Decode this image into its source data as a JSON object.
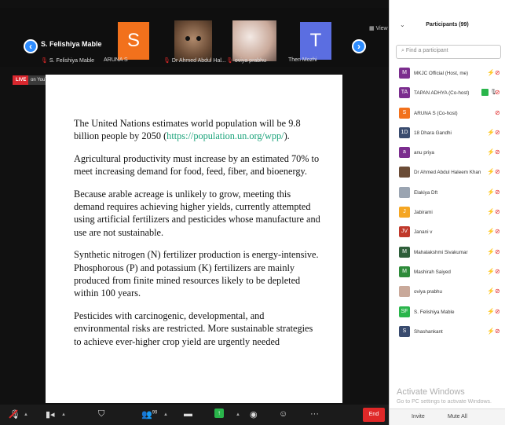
{
  "topstrip": {
    "active_speaker": "S. Felishiya Mable",
    "speaker_label": "S. Felishiya Mable",
    "tiles": [
      {
        "name": "ARUNA S",
        "avatar": "S"
      },
      {
        "name": "Dr Ahmed Abdul Hal..."
      },
      {
        "name": "oviya prabhu"
      },
      {
        "name": "Then Mozhi",
        "avatar": "T"
      }
    ],
    "view_label": "View"
  },
  "live": {
    "badge": "LIVE",
    "stream": "on YouTube ▾"
  },
  "slide": {
    "p1_text": "The United Nations estimates world population will be 9.8 billion people by 2050 (",
    "p1_link": "https://population.un.org/wpp/",
    "p1_end": ").",
    "p2": "Agricultural productivity must increase by an estimated 70% to meet increasing demand for food, feed, fiber, and bioenergy.",
    "p3": "Because arable acreage is unlikely to grow, meeting this demand requires achieving higher yields, currently attempted using artificial fertilizers and pesticides whose manufacture and use are not sustainable.",
    "p4": "Synthetic nitrogen (N) fertilizer production is energy-intensive. Phosphorous (P) and potassium (K) fertilizers are mainly produced from finite mined resources likely to be depleted within 100 years.",
    "p5": "Pesticides with carcinogenic, developmental, and environmental risks are restricted. More sustainable strategies to achieve ever-higher crop yield are urgently needed"
  },
  "toolbar": {
    "participants_count": "99",
    "end_label": "End"
  },
  "panel": {
    "title": "Participants (99)",
    "search_placeholder": "Find a participant",
    "participants": [
      {
        "name": "MKJC Official (Host, me)",
        "avatar": "M",
        "color": "#7b2d8e"
      },
      {
        "name": "TAPAN ADHYA (Co-host)",
        "avatar": "TA",
        "color": "#7b2d8e"
      },
      {
        "name": "ARUNA S (Co-host)",
        "avatar": "S",
        "color": "#f2711c"
      },
      {
        "name": "18 Dhara Gandhi",
        "avatar": "1D",
        "color": "#394b6e"
      },
      {
        "name": "anu priya",
        "avatar": "a",
        "color": "#7b2d8e"
      },
      {
        "name": "Dr Ahmed Abdul Haleem Khan",
        "avatar": "",
        "color": "#6b4c36"
      },
      {
        "name": "Elakiya Dft",
        "avatar": "",
        "color": "#9aa4b1"
      },
      {
        "name": "Jabirami",
        "avatar": "J",
        "color": "#f5a623"
      },
      {
        "name": "Janani  v",
        "avatar": "JV",
        "color": "#c0392b"
      },
      {
        "name": "Mahalakshmi Sivakumar",
        "avatar": "M",
        "color": "#2e5e3a"
      },
      {
        "name": "Mashirah Saiyed",
        "avatar": "M",
        "color": "#2e8b3a"
      },
      {
        "name": "oviya prabhu",
        "avatar": "",
        "color": "#c9a99a"
      },
      {
        "name": "S. Felishiya Mable",
        "avatar": "SF",
        "color": "#2ab54b"
      },
      {
        "name": "Shashankant",
        "avatar": "S",
        "color": "#394b6e"
      }
    ],
    "invite_label": "Invite",
    "mute_all_label": "Mute All"
  },
  "watermark": {
    "line1": "Activate Windows",
    "line2": "Go to PC settings to activate Windows."
  }
}
